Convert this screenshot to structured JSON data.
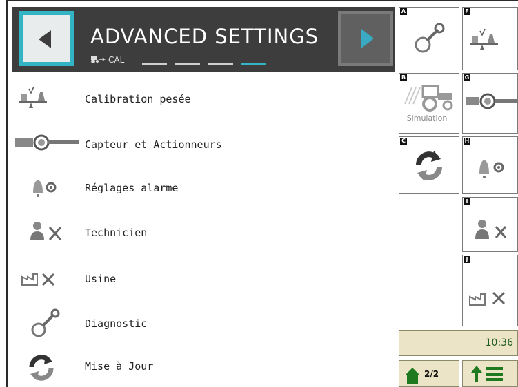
{
  "header": {
    "title": "ADVANCED SETTINGS",
    "sub_label": "CAL",
    "back_icon": "arrow-left-icon",
    "next_icon": "arrow-right-icon"
  },
  "menu": [
    {
      "label": "Calibration pesée",
      "icon": "scale-icon"
    },
    {
      "label": "Capteur et Actionneurs",
      "icon": "sensor-icon"
    },
    {
      "label": "Réglages alarme",
      "icon": "alarm-gear-icon"
    },
    {
      "label": "Technicien",
      "icon": "technician-icon"
    },
    {
      "label": "Usine",
      "icon": "factory-tools-icon"
    },
    {
      "label": "Diagnostic",
      "icon": "wrench-icon"
    },
    {
      "label": "Mise à Jour",
      "icon": "refresh-icon"
    }
  ],
  "tiles": {
    "A": "A",
    "B": "B",
    "C": "C",
    "F": "F",
    "G": "G",
    "H": "H",
    "I": "I",
    "J": "J",
    "simulation_label": "Simulation"
  },
  "status": {
    "time": "10:36",
    "page": "2/2"
  },
  "colors": {
    "header_bg": "#3d3d3d",
    "accent": "#33b4c4",
    "status_bg": "#ebe4c6"
  }
}
